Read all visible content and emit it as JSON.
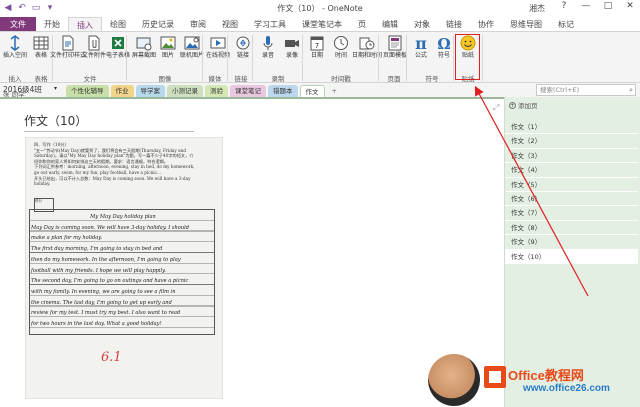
{
  "window": {
    "title": "作文（10） - OneNote",
    "user": "湘杰",
    "controls": [
      "?",
      "—",
      "□",
      "✕"
    ]
  },
  "ribbon_tabs": [
    "文件",
    "开始",
    "插入",
    "绘图",
    "历史记录",
    "审阅",
    "视图",
    "学习工具",
    "课堂笔记本",
    "页",
    "编辑",
    "对象",
    "链接",
    "协作",
    "思维导图",
    "标记"
  ],
  "ribbon": {
    "buttons": {
      "insert_space": "插入空间",
      "table": "表格",
      "file_printout": "文件打印样式",
      "file_attachment": "文件附件",
      "spreadsheet": "电子表格",
      "screen_clip": "屏幕截图",
      "picture": "图片",
      "online_picture": "联机图片",
      "online_video": "在线视频",
      "link": "链接",
      "audio": "录音",
      "video": "录像",
      "date": "日期",
      "time": "时间",
      "date_time": "日期和时间",
      "page_template": "页面模板",
      "equation": "公式",
      "symbol": "符号",
      "sticker": "贴纸"
    },
    "groups": {
      "insert": "插入",
      "tables": "表格",
      "files": "文件",
      "images": "图像",
      "media": "媒体",
      "links": "链接",
      "recording": "录制",
      "timestamp": "时间戳",
      "pages": "页面",
      "symbols": "符号",
      "stickers": "贴纸"
    }
  },
  "notebook": {
    "name": "2016级4班",
    "sub": "张 同学",
    "sections": [
      {
        "label": "个性化辅导",
        "color": "#c9dfa8"
      },
      {
        "label": "作业",
        "color": "#f2d38a"
      },
      {
        "label": "导学案",
        "color": "#b8d9ec"
      },
      {
        "label": "小测记录",
        "color": "#cfe0c1"
      },
      {
        "label": "测验",
        "color": "#d4e8b3"
      },
      {
        "label": "课堂笔记",
        "color": "#e8c7df"
      },
      {
        "label": "错题本",
        "color": "#bcd8ef"
      },
      {
        "label": "作文",
        "color": "#ffffff"
      }
    ],
    "add_section": "+",
    "search_placeholder": "搜索(Ctrl+E)"
  },
  "page": {
    "title": "作文（10）"
  },
  "scan": {
    "print_lines": [
      "四、写作（10分）",
      "\"五一\"劳动节(May Day)就要到了，我们将会有三天假期(Thursday, Friday and",
      "Saturday)。请以\"My May Day holiday plan\"为题，写一篇不少于40字的短文，介",
      "绍你和你的家人将如何安排这三天的假期。要求：语言通顺，符合逻辑。",
      "下列词汇供参考：morning, afternoon, evening, stay in bed, do my homework,",
      "go out early, swim; for my fun, play football, have a picnic...",
      "开头已给出，可以不计入总数：May Day is coming soon. We will have a 3-day holiday."
    ],
    "box_label": "得分",
    "hand_lines": [
      "My  May  Day  holiday  plan",
      "May Day is coming soon. We will have 3-day holiday. I should",
      "make  a  plan  for  my  holiday.",
      "The first day morning, I'm going to stay in bed and",
      "then do my homework. In the afternoon, I'm going to play",
      "football with my friends. I hope we will play happily.",
      "The second day, I'm going to go on outings and have a picnic",
      "with my family. In evening, we are going to see a film in",
      "the cinema. The last day, I'm going to get up early and",
      "review for my test. I must try my best. I also want to read",
      "for two hours in the last day. What a good holiday!"
    ],
    "grade": "6.1"
  },
  "pages_panel": {
    "add_page": "添加页",
    "items": [
      "作文（1）",
      "作文（2）",
      "作文（3）",
      "作文（4）",
      "作文（5）",
      "作文（6）",
      "作文（7）",
      "作文（8）",
      "作文（9）",
      "作文（10）"
    ],
    "selected_index": 9
  },
  "watermark": {
    "brand": "Office教程网",
    "site": "www.office26.com"
  },
  "colors": {
    "accent": "#80397b",
    "highlight_box": "#e02020",
    "panel_bg": "#e3efe2"
  }
}
